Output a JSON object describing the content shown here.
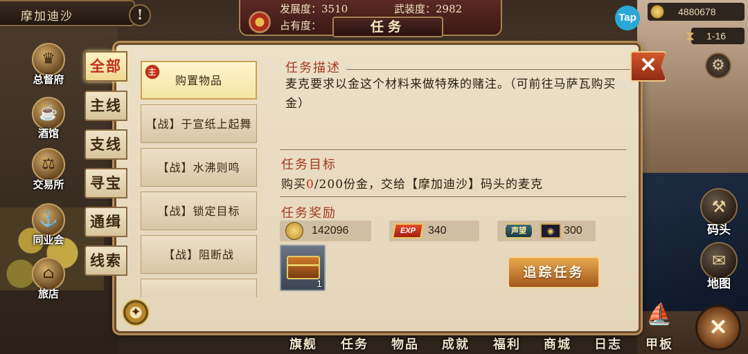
{
  "top": {
    "location": "摩加迪沙",
    "dev_label": "发展度：",
    "dev_value": "3510",
    "arm_label": "武装度：",
    "arm_value": "2982",
    "occ_label": "占有度：",
    "title": "任务",
    "tap_logo": "Tap",
    "coins": "4880678",
    "time": "1-16"
  },
  "left_nav": [
    {
      "label": "总督府",
      "icon": "crown-icon"
    },
    {
      "label": "酒馆",
      "icon": "beer-mug-icon"
    },
    {
      "label": "交易所",
      "icon": "scales-icon"
    },
    {
      "label": "同业会",
      "icon": "anchor-emblem-icon"
    },
    {
      "label": "旅店",
      "icon": "inn-icon"
    }
  ],
  "right_nav": [
    {
      "label": "码头",
      "icon": "dock-icon"
    },
    {
      "label": "地图",
      "icon": "map-scroll-icon"
    }
  ],
  "categories": [
    "全部",
    "主线",
    "支线",
    "寻宝",
    "通缉",
    "线索"
  ],
  "quests": [
    {
      "label": "购置物品",
      "badge": "主",
      "selected": true
    },
    {
      "label": "【战】于宣纸上起舞"
    },
    {
      "label": "【战】水沸则鸣"
    },
    {
      "label": "【战】锁定目标"
    },
    {
      "label": "【战】阻断战"
    }
  ],
  "detail": {
    "desc_title": "任务描述",
    "desc_text": "麦克要求以金这个材料来做特殊的赌注。（可前往马萨瓦购买金）",
    "goal_title": "任务目标",
    "goal_prefix": "购买",
    "goal_current": "0",
    "goal_suffix": "/200份金，交给【摩加迪沙】码头的麦克",
    "reward_title": "任务奖励",
    "reward_coins": "142096",
    "exp_label": "EXP",
    "reward_exp": "340",
    "fame_label": "声望",
    "reward_fame": "300",
    "item_count": "1",
    "track_label": "追踪任务"
  },
  "bottom_nav": [
    "旗舰",
    "任务",
    "物品",
    "成就",
    "福利",
    "商城",
    "日志",
    "甲板"
  ],
  "colors": {
    "accent_red": "#a23a20",
    "goal_current": "#d0281a",
    "panel_bg": "#ece0c8"
  }
}
